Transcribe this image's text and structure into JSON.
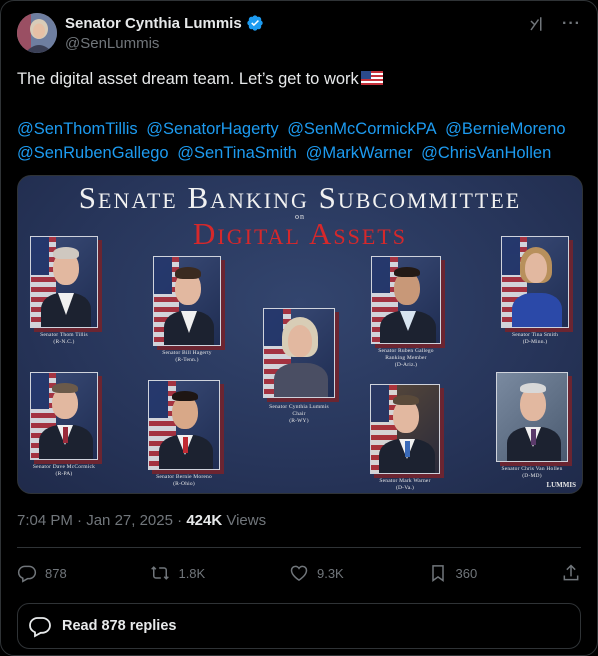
{
  "author": {
    "display_name": "Senator Cynthia Lummis",
    "handle": "@SenLummis"
  },
  "tweet": {
    "text": "The digital asset dream team. Let’s get to work",
    "mentions": [
      "@SenThomTillis",
      "@SenatorHagerty",
      "@SenMcCormickPA",
      "@BernieMoreno",
      "@SenRubenGallego",
      "@SenTinaSmith",
      "@MarkWarner",
      "@ChrisVanHollen"
    ]
  },
  "media": {
    "title": "Senate Banking Subcommittee",
    "on": "on",
    "subtitle": "Digital Assets",
    "watermark": "LUMMIS",
    "portraits": [
      {
        "caption": "Senator Thom Tillis\n(R-N.C.)"
      },
      {
        "caption": "Senator Bill Hagerty\n(R-Tenn.)"
      },
      {
        "caption": "Senator Cynthia Lummis\nChair\n(R-WY)"
      },
      {
        "caption": "Senator Ruben Gallego\nRanking Member\n(D-Ariz.)"
      },
      {
        "caption": "Senator Tina Smith\n(D-Minn.)"
      },
      {
        "caption": "Senator Dave McCormick\n(R-PA)"
      },
      {
        "caption": "Senator Bernie Moreno\n(R-Ohio)"
      },
      {
        "caption": "Senator Mark Warner\n(D-Va.)"
      },
      {
        "caption": "Senator Chris Van Hollen\n(D-MD)"
      }
    ]
  },
  "meta": {
    "time": "7:04 PM",
    "sep1": " · ",
    "date": "Jan 27, 2025",
    "sep2": " · ",
    "views_count": "424K",
    "views_label": " Views"
  },
  "actions": {
    "replies": "878",
    "reposts": "1.8K",
    "likes": "9.3K",
    "bookmarks": "360"
  },
  "read_replies": "Read 878 replies",
  "colors": {
    "link": "#1d9bf0",
    "verified": "#1d9bf0",
    "banner_red": "#d6282b"
  }
}
